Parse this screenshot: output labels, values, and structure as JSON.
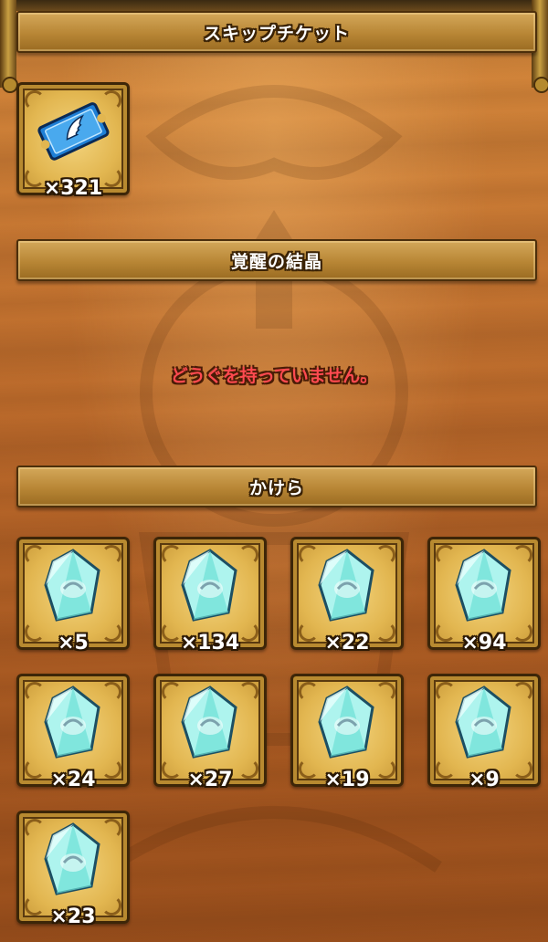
{
  "sections": {
    "skip_ticket": {
      "title": "スキップチケット",
      "items": [
        {
          "icon": "skip-ticket-icon",
          "qty": "×321"
        }
      ]
    },
    "awakening_crystal": {
      "title": "覚醒の結晶",
      "empty_message": "どうぐを持っていません。"
    },
    "fragments": {
      "title": "かけら",
      "items": [
        {
          "icon": "crystal-fragment-icon",
          "qty": "×5"
        },
        {
          "icon": "crystal-fragment-icon",
          "qty": "×134"
        },
        {
          "icon": "crystal-fragment-icon",
          "qty": "×22"
        },
        {
          "icon": "crystal-fragment-icon",
          "qty": "×94"
        },
        {
          "icon": "crystal-fragment-icon",
          "qty": "×24"
        },
        {
          "icon": "crystal-fragment-icon",
          "qty": "×27"
        },
        {
          "icon": "crystal-fragment-icon",
          "qty": "×19"
        },
        {
          "icon": "crystal-fragment-icon",
          "qty": "×9"
        },
        {
          "icon": "crystal-fragment-icon",
          "qty": "×23"
        }
      ]
    }
  },
  "colors": {
    "panel_bar": "#b88635",
    "empty_text": "#ff4a50",
    "card_bg": "#e2b650",
    "crystal": "#7ee8e0"
  }
}
